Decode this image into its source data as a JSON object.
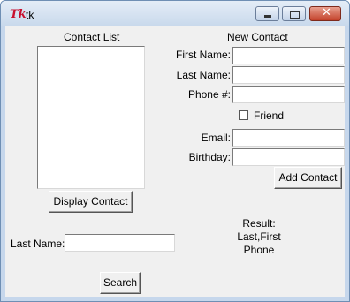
{
  "window": {
    "title": "tk",
    "logo_text": "Tk"
  },
  "contact_list": {
    "heading": "Contact List",
    "items": []
  },
  "new_contact": {
    "heading": "New Contact",
    "first_name_label": "First Name:",
    "first_name_value": "",
    "last_name_label": "Last Name:",
    "last_name_value": "",
    "phone_label": "Phone #:",
    "phone_value": "",
    "friend_label": "Friend",
    "friend_checked": false,
    "email_label": "Email:",
    "email_value": "",
    "birthday_label": "Birthday:",
    "birthday_value": "",
    "add_button": "Add Contact"
  },
  "display_button": "Display Contact",
  "search": {
    "last_name_label": "Last Name:",
    "last_name_value": "",
    "search_button": "Search"
  },
  "result": {
    "line1": "Result:",
    "line2": "Last,First",
    "line3": "Phone"
  }
}
